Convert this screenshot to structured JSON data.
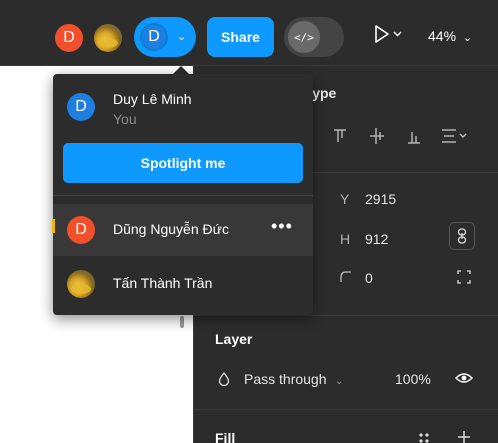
{
  "toolbar": {
    "avatars": [
      {
        "initial": "D",
        "color": "#f2502d"
      },
      {
        "initial": "",
        "kind": "photo"
      }
    ],
    "me_avatar": {
      "initial": "D",
      "color": "#1e7fe0"
    },
    "share_label": "Share",
    "dev_mode_icon": "</>",
    "play_icon": "play-icon",
    "zoom_label": "44%"
  },
  "right_panel": {
    "section_partial_label": "otype",
    "y_label": "Y",
    "y_value": "2915",
    "h_label": "H",
    "h_value": "912",
    "radius_value": "0",
    "layer_title": "Layer",
    "blend_mode": "Pass through",
    "opacity": "100%",
    "fill_title": "Fill"
  },
  "dropdown": {
    "self": {
      "initial": "D",
      "name": "Duy Lê Minh",
      "subtitle": "You"
    },
    "spotlight_label": "Spotlight me",
    "others": [
      {
        "initial": "D",
        "name": "Dũng Nguyễn Đức",
        "more": "•••"
      },
      {
        "initial": "",
        "name": "Tấn Thành Trần"
      }
    ]
  },
  "colors": {
    "accent": "#0d99ff",
    "panel_bg": "#2c2c2c",
    "avatar_orange": "#f2502d",
    "avatar_blue": "#1e7fe0"
  }
}
